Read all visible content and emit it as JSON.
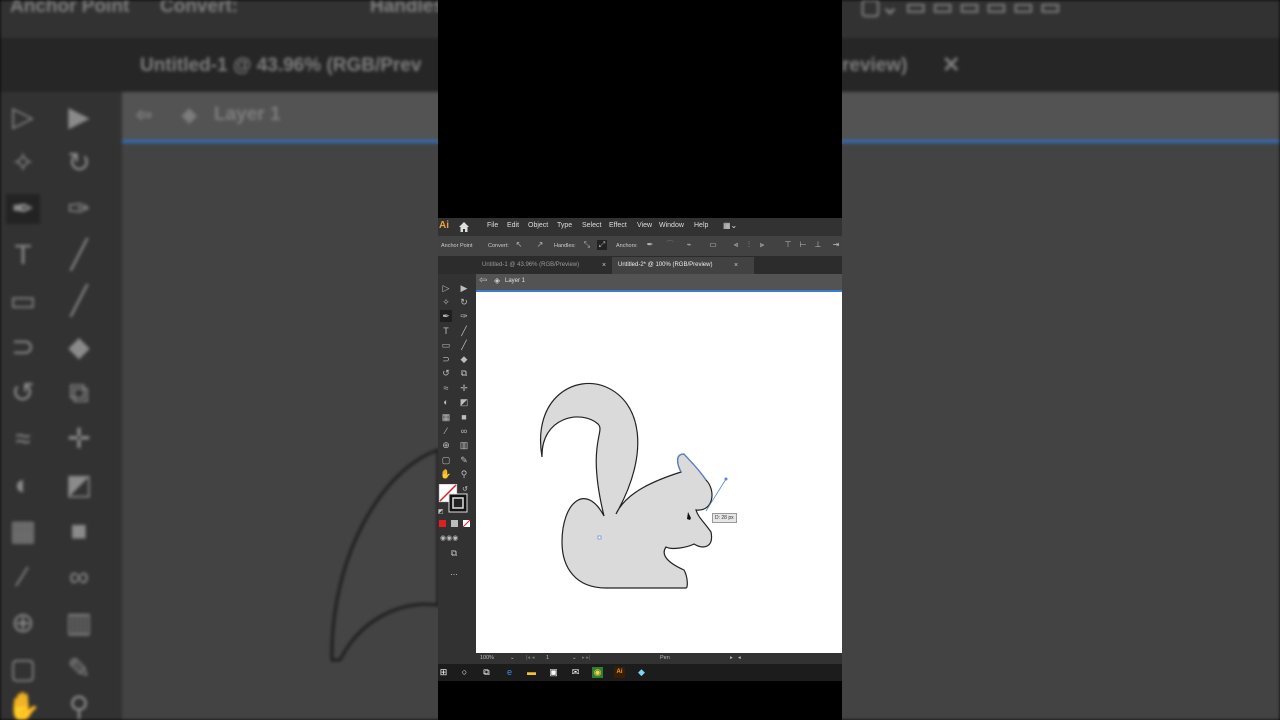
{
  "background": {
    "toolbar_labels": [
      "Anchor Point",
      "Convert:",
      "Handles"
    ],
    "doc_tab_title": "Untitled-1 @ 43.96% (RGB/Prev",
    "doc_tab_title_tail": "review)",
    "layer_label": "Layer 1"
  },
  "app": {
    "logo": "Ai",
    "menu": [
      "File",
      "Edit",
      "Object",
      "Type",
      "Select",
      "Effect",
      "View",
      "Window",
      "Help"
    ],
    "control_bar": {
      "anchor_point_label": "Anchor Point",
      "convert_label": "Convert:",
      "handles_label": "Handles:",
      "anchors_label": "Anchors:"
    },
    "tabs": [
      {
        "label": "Untitled-1 @ 43.96% (RGB/Preview)",
        "close": "×",
        "active": false
      },
      {
        "label": "Untitled-2* @ 100% (RGB/Preview)",
        "close": "×",
        "active": true
      }
    ],
    "layer_label": "Layer 1",
    "tooltip": "D: 28 px",
    "status": {
      "zoom": "100%",
      "artboard": "1",
      "tool": "Pen"
    },
    "more_tools": "..."
  },
  "colors": {
    "accent_blue": "#3d7bd0",
    "squirrel_fill": "#dadada",
    "ai_orange": "#f2a13a",
    "path_selection": "#5b86d6"
  },
  "icons": {
    "tools": [
      "selection-arrow",
      "direct-selection",
      "magic-wand",
      "lasso",
      "pen",
      "curvature",
      "type",
      "line",
      "rectangle",
      "paintbrush",
      "shaper",
      "eraser",
      "rotate",
      "scale",
      "width",
      "puppet-warp",
      "shape-builder",
      "perspective",
      "mesh",
      "gradient",
      "eyedropper",
      "blend",
      "symbol-sprayer",
      "column-graph",
      "artboard",
      "slice",
      "hand",
      "zoom"
    ]
  }
}
